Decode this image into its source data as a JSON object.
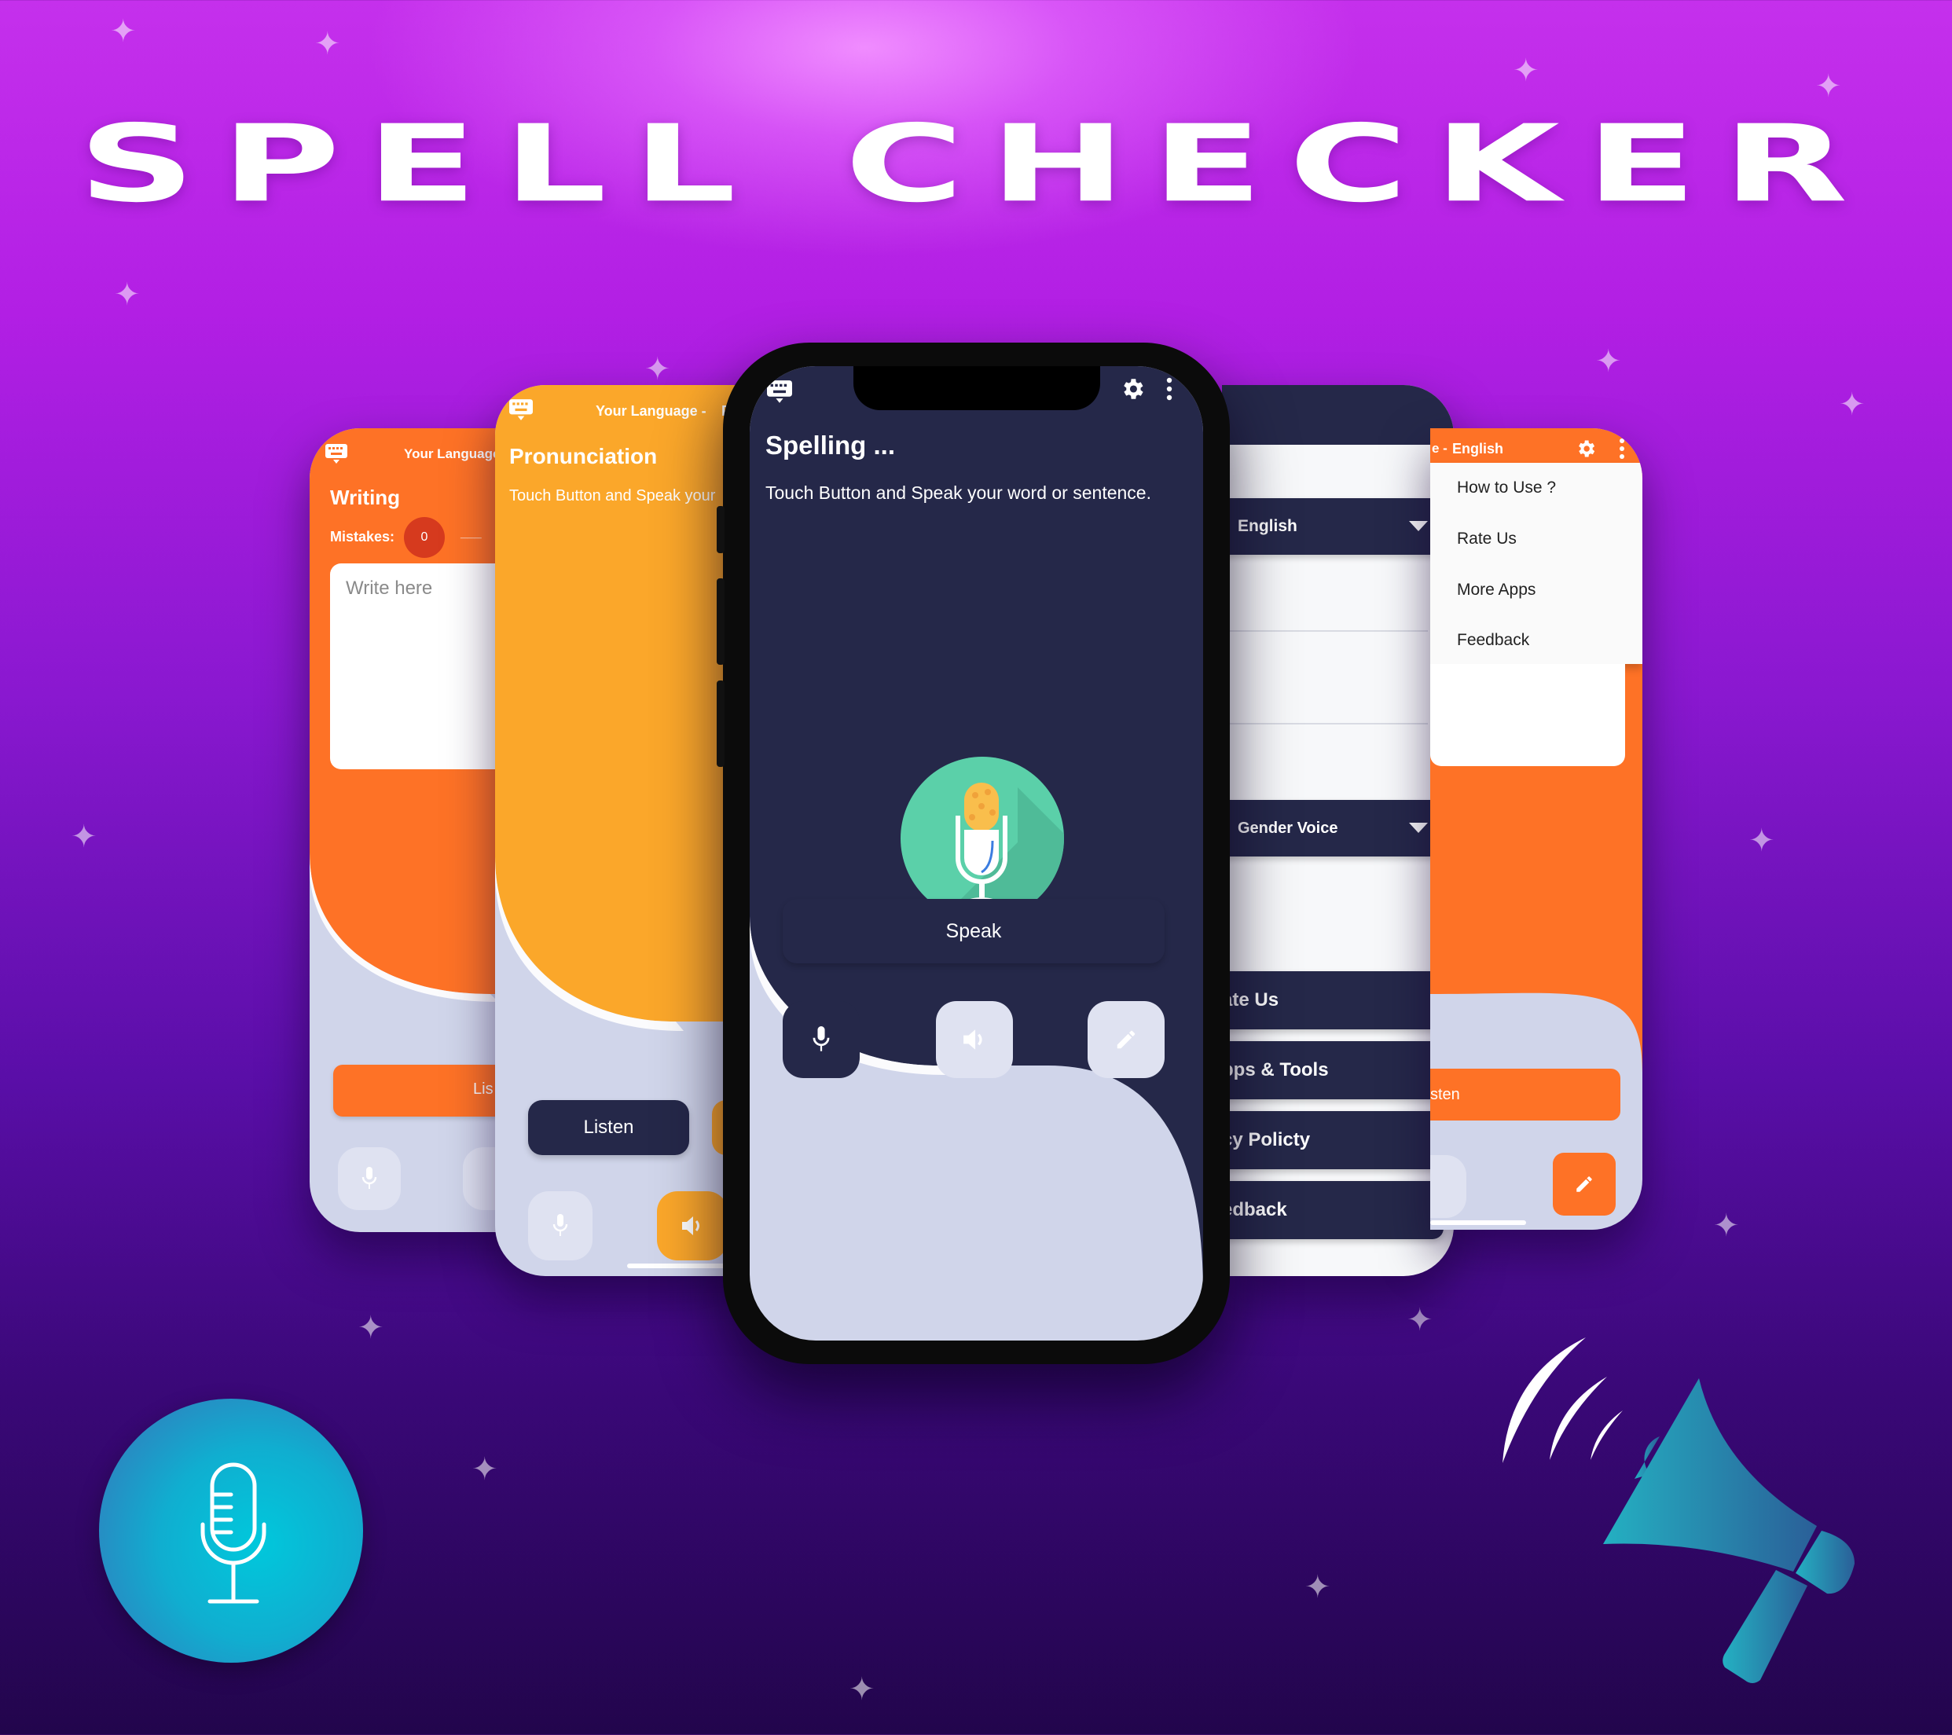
{
  "banner": {
    "title": "SPELL CHECKER"
  },
  "colors": {
    "orange": "#fe7226",
    "amber": "#fba72a",
    "navy": "#252849",
    "lavender": "#d0d5ea",
    "teal": "#5bd0a9",
    "mistake_red": "#d63a1e"
  },
  "writing_screen": {
    "header_language": "Your Language",
    "title": "Writing",
    "mistakes_label": "Mistakes:",
    "mistakes_count": "0",
    "mistakes_placeholder": "___",
    "text_area_placeholder": "Write here",
    "listen_button": "Lis",
    "nav": [
      "mic-icon",
      "speaker-icon"
    ]
  },
  "pronunciation_screen": {
    "header_language": "Your Language -",
    "header_trailing": "F",
    "title": "Pronunciation",
    "subtitle": "Touch Button and Speak your",
    "listen_button": "Listen",
    "nav": [
      "mic-icon",
      "speaker-icon"
    ]
  },
  "spelling_screen": {
    "title": "Spelling ...",
    "subtitle": "Touch Button and Speak your word or sentence.",
    "speak_button": "Speak",
    "nav": [
      "mic-icon",
      "speaker-icon",
      "pencil-icon"
    ]
  },
  "settings_screen": {
    "language_select": "English",
    "voice_select": "Gender Voice",
    "buttons": [
      "ate Us",
      "pps & Tools",
      "cy Policty",
      "edback"
    ]
  },
  "menu_screen": {
    "header_prefix": "e -",
    "header_language": "English",
    "menu_items": [
      "How to Use ?",
      "Rate Us",
      "More Apps",
      "Feedback"
    ],
    "listen_button": "sten"
  }
}
